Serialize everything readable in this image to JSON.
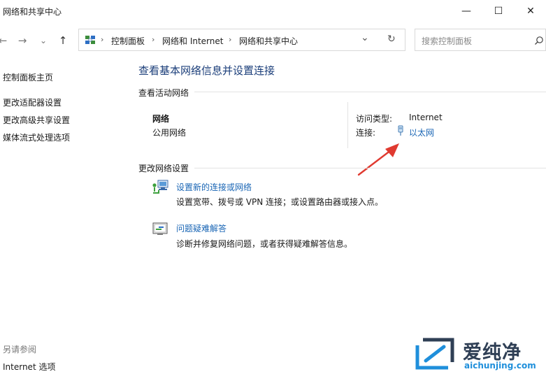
{
  "window": {
    "title": "网络和共享中心",
    "minimize_glyph": "—",
    "maximize_glyph": "☐",
    "close_glyph": "✕"
  },
  "nav": {
    "back_glyph": "←",
    "forward_glyph": "→",
    "recent_glyph": "⌄",
    "up_glyph": "↑",
    "dropdown_glyph": "⌄",
    "refresh_glyph": "↻",
    "breadcrumb": [
      "控制面板",
      "网络和 Internet",
      "网络和共享中心"
    ],
    "separator": "›"
  },
  "search": {
    "placeholder": "搜索控制面板",
    "icon_glyph": "⚲"
  },
  "sidebar": {
    "home": "控制面板主页",
    "links": [
      "更改适配器设置",
      "更改高级共享设置",
      "媒体流式处理选项"
    ],
    "see_also_title": "另请参阅",
    "see_also": [
      "Internet 选项"
    ]
  },
  "main": {
    "title": "查看基本网络信息并设置连接",
    "active_section": "查看活动网络",
    "network_name": "网络",
    "network_type": "公用网络",
    "access_type_label": "访问类型:",
    "access_type_value": "Internet",
    "connection_label": "连接:",
    "connection_value": "以太网",
    "change_section": "更改网络设置",
    "tasks": [
      {
        "link": "设置新的连接或网络",
        "desc": "设置宽带、拨号或 VPN 连接；或设置路由器或接入点。"
      },
      {
        "link": "问题疑难解答",
        "desc": "诊断并修复网络问题，或者获得疑难解答信息。"
      }
    ]
  },
  "watermark": {
    "text": "爱纯净",
    "url": "aichunjing.com"
  },
  "colors": {
    "accent": "#1a66b5",
    "title": "#1b3e7a",
    "arrow": "#e03a30"
  }
}
